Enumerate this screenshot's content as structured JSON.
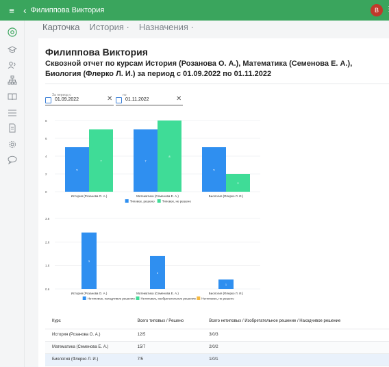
{
  "app": {
    "title": "Филиппова Виктория",
    "avatar_initial": "В",
    "more": "⋮"
  },
  "tabs": [
    {
      "label": "Карточка",
      "active": true
    },
    {
      "label": "История ·",
      "active": false
    },
    {
      "label": "Назначения ·",
      "active": false
    }
  ],
  "report": {
    "title": "Филиппова Виктория",
    "subtitle": "Сквозной отчет по курсам История (Розанова О. А.), Математика (Семенова Е. А.), Биология (Флерко Л. И.) за период с 01.09.2022 по 01.11.2022"
  },
  "filters": {
    "from": {
      "label": "За период с",
      "value": "01.09.2022"
    },
    "to": {
      "label": "по",
      "value": "01.11.2022"
    },
    "clear_glyph": "✕"
  },
  "chart_data": [
    {
      "type": "bar",
      "categories": [
        "История (Розанова О. А.)",
        "Математика (Семенова Е. А.)",
        "Биология (Флерко Л. И.)"
      ],
      "series": [
        {
          "name": "Типовое, решено",
          "values": [
            5,
            7,
            5
          ],
          "color": "#2f8ff0"
        },
        {
          "name": "Типовое, не решено",
          "values": [
            7,
            8,
            2
          ],
          "color": "#3fdc97"
        }
      ],
      "yticks": [
        "0",
        "2",
        "4",
        "6",
        "8"
      ],
      "ylim": [
        0,
        8
      ],
      "legend_position": "bottom"
    },
    {
      "type": "bar",
      "categories": [
        "История (Розанова О. А.)",
        "Математика (Семенова Е. А.)",
        "Биология (Флерко Л. И.)"
      ],
      "series": [
        {
          "name": "Нетиповое, находчивое решение",
          "values": [
            3,
            2,
            1
          ],
          "color": "#2f8ff0"
        },
        {
          "name": "Нетиповое, изобретательное решение",
          "values": [
            0,
            0,
            0
          ],
          "color": "#3fdc97"
        },
        {
          "name": "Нетиповое, не решено",
          "values": [
            0,
            0,
            0
          ],
          "color": "#f5b942"
        }
      ],
      "yticks": [
        "0.6",
        "1.6",
        "2.6",
        "3.6"
      ],
      "ylim": [
        0.6,
        3.6
      ],
      "legend_position": "bottom"
    }
  ],
  "table": {
    "headers": [
      "Курс",
      "Всего типовых / Решено",
      "Всего нетиповых / Изобретательное решение / Находчивое решение"
    ],
    "rows": [
      [
        "История (Розанова О. А.)",
        "12/5",
        "3/0/3"
      ],
      [
        "Математика (Семенова Е. А.)",
        "15/7",
        "2/0/2"
      ],
      [
        "Биология (Флерко Л. И.)",
        "7/5",
        "1/0/1"
      ]
    ]
  },
  "sidebar": [
    "home-icon",
    "graduation-cap-icon",
    "users-icon",
    "org-chart-icon",
    "book-icon",
    "list-icon",
    "document-icon",
    "gear-icon",
    "chat-icon"
  ]
}
